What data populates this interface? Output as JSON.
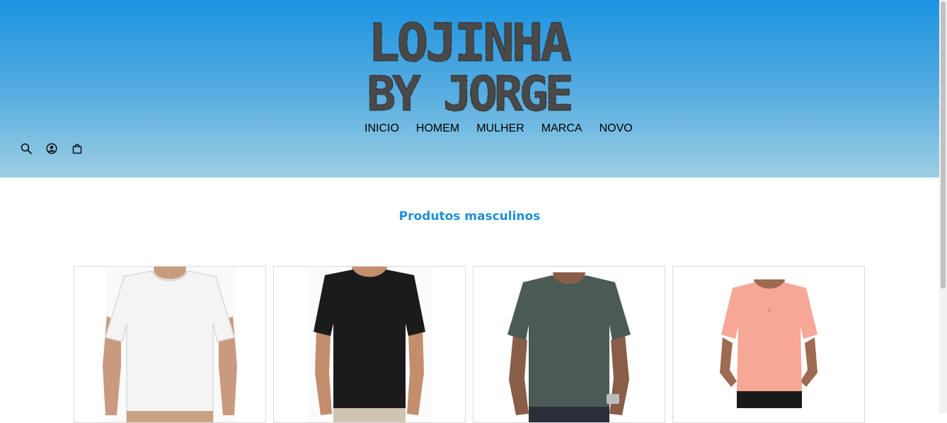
{
  "brand": {
    "logo_line1": "LOJINHA",
    "logo_line2": "BY JORGE"
  },
  "nav": {
    "items": [
      {
        "label": "INICIO"
      },
      {
        "label": "HOMEM"
      },
      {
        "label": "MULHER"
      },
      {
        "label": "MARCA"
      },
      {
        "label": "NOVO"
      }
    ]
  },
  "header_icons": [
    "search-icon",
    "user-icon",
    "shopping-bag-icon"
  ],
  "section": {
    "title": "Produtos masculinos"
  },
  "products": [
    {
      "name": "white-tshirt",
      "color": "#f4f4f4"
    },
    {
      "name": "black-tshirt",
      "color": "#1b1b1b"
    },
    {
      "name": "dark-green-tshirt",
      "color": "#4b5a55"
    },
    {
      "name": "salmon-tshirt",
      "color": "#f7a796"
    }
  ],
  "colors": {
    "accent": "#1e8fd8",
    "header_top": "#1b93e2",
    "header_bottom": "#9dcfe4"
  }
}
